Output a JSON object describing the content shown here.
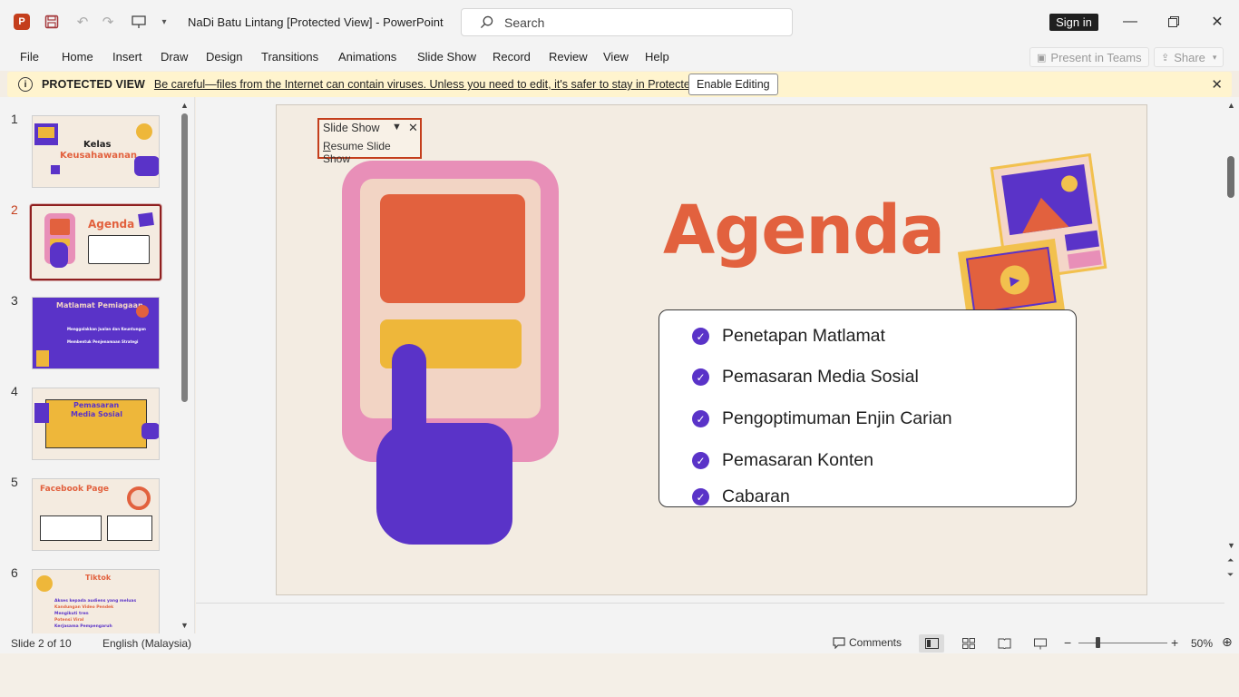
{
  "titlebar": {
    "app_letter": "P",
    "title": "NaDi Batu Lintang [Protected View]  -  PowerPoint",
    "search_placeholder": "Search",
    "signin": "Sign in"
  },
  "menu": {
    "items": [
      "File",
      "Home",
      "Insert",
      "Draw",
      "Design",
      "Transitions",
      "Animations",
      "Slide Show",
      "Record",
      "Review",
      "View",
      "Help"
    ],
    "present_in_teams": "Present in Teams",
    "share": "Share"
  },
  "protected": {
    "title": "PROTECTED VIEW",
    "message": "Be careful—files from the Internet can contain viruses. Unless you need to edit, it's safer to stay in Protected View.",
    "button": "Enable Editing"
  },
  "thumbnails": [
    {
      "num": "1",
      "title": "Kelas",
      "subtitle": "Keusahawanan"
    },
    {
      "num": "2",
      "title": "Agenda"
    },
    {
      "num": "3",
      "title": "Matlamat Pemiagaan",
      "line1": "Menggalakkan Jualan dan Keuntungan",
      "line2": "Membentuk Penjenamaan Strategi"
    },
    {
      "num": "4",
      "title": "Pemasaran",
      "subtitle": "Media Sosial"
    },
    {
      "num": "5",
      "title": "Facebook Page"
    },
    {
      "num": "6",
      "title": "Tiktok",
      "bullets": [
        "Akses kepada audiens yang meluas",
        "Kandungan Video Pendek",
        "Mengikuti tren",
        "Potensi Viral",
        "Kerjasama Pempengaruh"
      ]
    }
  ],
  "slide": {
    "title": "Agenda",
    "items": [
      "Penetapan Matlamat",
      "Pemasaran Media Sosial",
      "Pengoptimuman Enjin Carian",
      "Pemasaran Konten",
      "Cabaran"
    ]
  },
  "slideshow_popup": {
    "label": "Slide Show",
    "resume": "Resume Slide Show"
  },
  "status": {
    "slide_of": "Slide 2 of 10",
    "language": "English (Malaysia)",
    "comments": "Comments",
    "zoom": "50%",
    "zoom_level": 0.5
  }
}
